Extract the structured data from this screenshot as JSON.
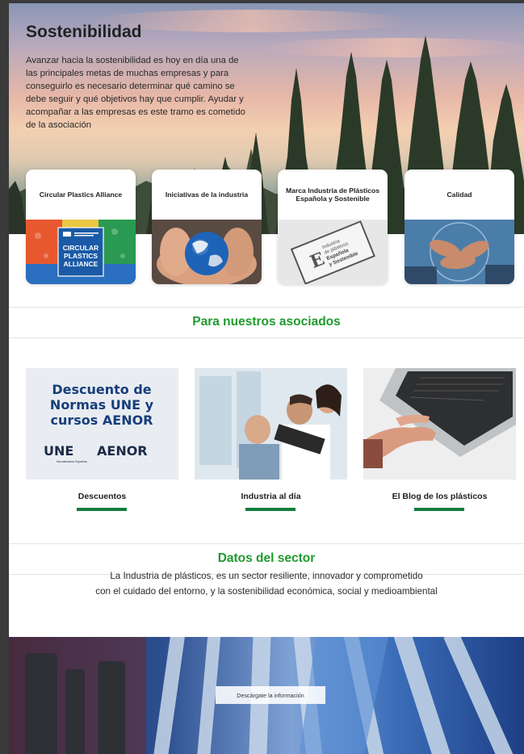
{
  "hero": {
    "title": "Sostenibilidad",
    "text": "Avanzar hacia la sostenibilidad es hoy en día una de las principales metas de muchas empresas y para conseguirlo es necesario determinar qué camino se debe seguir y qué objetivos hay que cumplir. Ayudar y acompañar a las empresas es este tramo es cometido de la asociación"
  },
  "cards": [
    {
      "label": "Circular Plastics Alliance",
      "logo_lines": [
        "CIRCULAR",
        "PLASTICS",
        "ALLIANCE"
      ]
    },
    {
      "label": "Iniciativas de la industria"
    },
    {
      "label": "Marca Industria de Plásticos Española y Sostenible",
      "stamp_lines": [
        "Industria",
        "de plásticos",
        "Española",
        "y Sostenible"
      ]
    },
    {
      "label": "Calidad"
    }
  ],
  "associates": {
    "title": "Para nuestros asociados",
    "tiles": [
      {
        "label": "Descuentos",
        "promo_lines": [
          "Descuento de",
          "Normas UNE y",
          "cursos AENOR"
        ],
        "logo_une": "UNE",
        "logo_une_sub": "Normalización Española",
        "logo_aenor": "AENOR"
      },
      {
        "label": "Industria al día"
      },
      {
        "label": "El Blog de los plásticos"
      }
    ]
  },
  "sector": {
    "title": "Datos del sector",
    "line1": "La Industria de plásticos, es un sector resiliente, innovador y comprometido",
    "line2": "con el cuidado del entorno, y la sostenibilidad económica, social y medioambiental"
  },
  "download_button": "Descárgate la información",
  "colors": {
    "accent_green": "#1f9a2e",
    "bar_green": "#127d3d",
    "cpa_blue": "#1a5aa6"
  }
}
